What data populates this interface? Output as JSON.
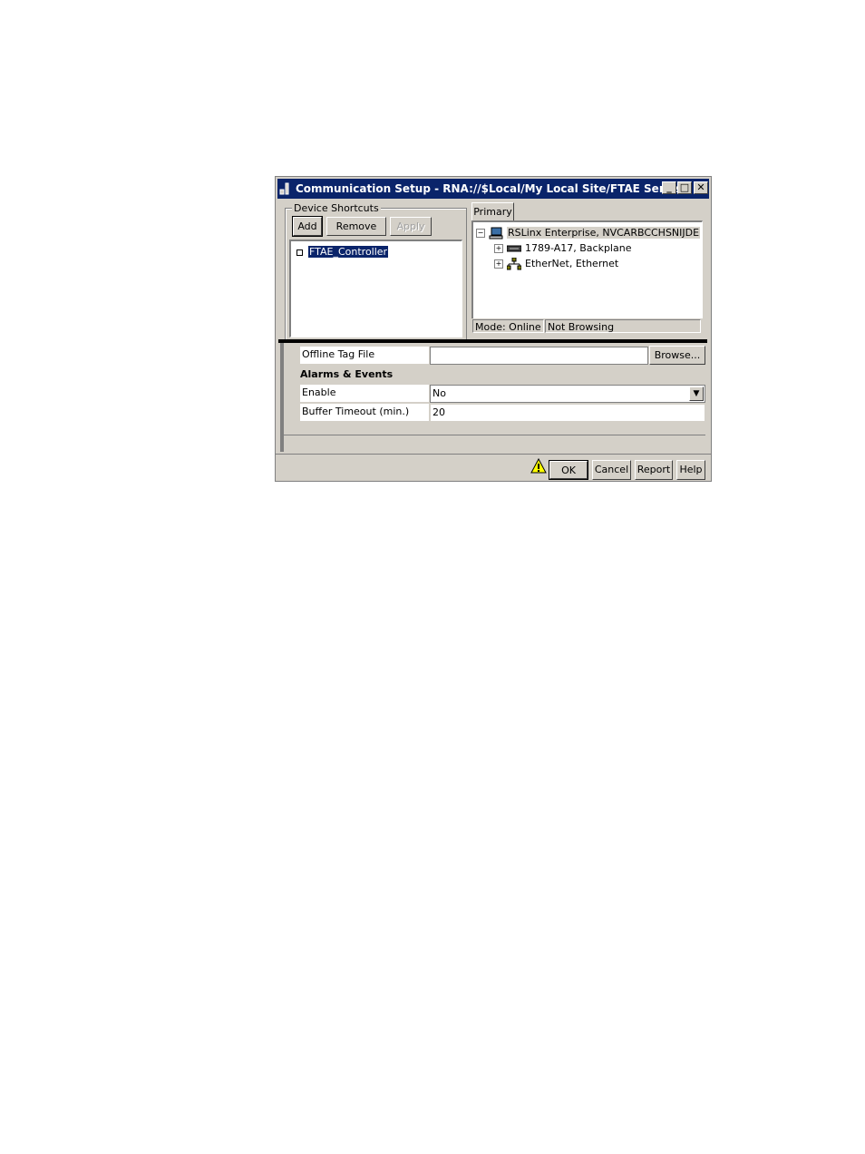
{
  "window": {
    "title": "Communication Setup - RNA://$Local/My Local Site/FTAE Server",
    "controls": [
      "_",
      "□",
      "✕"
    ]
  },
  "shortcuts": {
    "group_label": "Device Shortcuts",
    "add_label": "Add",
    "remove_label": "Remove",
    "apply_label": "Apply",
    "items": [
      "FTAE_Controller"
    ]
  },
  "primary": {
    "tab_label": "Primary",
    "tree": {
      "root": "RSLinx Enterprise, NVCARBCCHSNIJDE",
      "children": [
        "1789-A17, Backplane",
        "EtherNet, Ethernet"
      ]
    },
    "status": {
      "mode": "Mode: Online",
      "browse": "Not Browsing"
    }
  },
  "properties": {
    "offline_tag_label": "Offline Tag File",
    "offline_tag_value": "",
    "browse_label": "Browse...",
    "section_title": "Alarms & Events",
    "enable_label": "Enable",
    "enable_value": "No",
    "buffer_label": "Buffer Timeout (min.)",
    "buffer_value": "20"
  },
  "footer": {
    "ok_label": "OK",
    "cancel_label": "Cancel",
    "report_label": "Report",
    "help_label": "Help"
  }
}
